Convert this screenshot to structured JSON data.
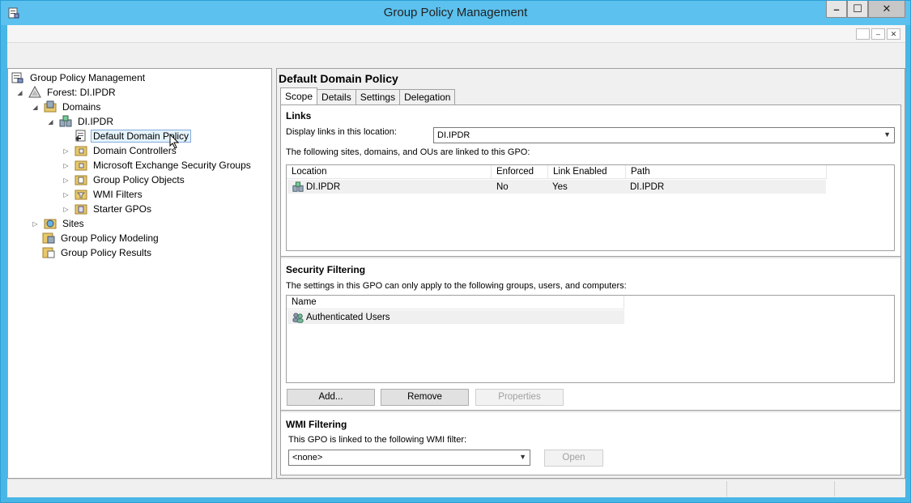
{
  "window": {
    "title": "Group Policy Management",
    "controls": {
      "minimize": "–",
      "maximize": "☐",
      "close": "✕"
    }
  },
  "mdi_controls": [
    "",
    "–",
    "✕"
  ],
  "tree": {
    "nodes": [
      {
        "label": "Group Policy Management",
        "icon": "gpmc-console-icon",
        "expander": "",
        "level": 0
      },
      {
        "label": "Forest: DI.IPDR",
        "icon": "forest-icon",
        "expander": "◢",
        "level": 1
      },
      {
        "label": "Domains",
        "icon": "domains-folder-icon",
        "expander": "◢",
        "level": 2
      },
      {
        "label": "DI.IPDR",
        "icon": "domain-icon",
        "expander": "◢",
        "level": 3
      },
      {
        "label": "Default Domain Policy",
        "icon": "gpo-link-icon",
        "expander": "",
        "level": 4,
        "selected": true
      },
      {
        "label": "Domain Controllers",
        "icon": "ou-folder-icon",
        "expander": "▷",
        "level": 4
      },
      {
        "label": "Microsoft Exchange Security Groups",
        "icon": "ou-folder-icon",
        "expander": "▷",
        "level": 4
      },
      {
        "label": "Group Policy Objects",
        "icon": "gpo-folder-icon",
        "expander": "▷",
        "level": 4
      },
      {
        "label": "WMI Filters",
        "icon": "wmi-folder-icon",
        "expander": "▷",
        "level": 4
      },
      {
        "label": "Starter GPOs",
        "icon": "starter-gpo-folder-icon",
        "expander": "▷",
        "level": 4
      },
      {
        "label": "Sites",
        "icon": "sites-icon",
        "expander": "▷",
        "level": 2
      },
      {
        "label": "Group Policy Modeling",
        "icon": "modeling-icon",
        "expander": "",
        "level": 2
      },
      {
        "label": "Group Policy Results",
        "icon": "results-icon",
        "expander": "",
        "level": 2
      }
    ]
  },
  "details": {
    "title": "Default Domain Policy",
    "tabs": [
      "Scope",
      "Details",
      "Settings",
      "Delegation"
    ],
    "links": {
      "section_title": "Links",
      "location_label": "Display links in this location:",
      "location_value": "DI.IPDR",
      "linked_label": "The following sites, domains, and OUs are linked to this GPO:",
      "columns": [
        "Location",
        "Enforced",
        "Link Enabled",
        "Path"
      ],
      "rows": [
        {
          "location": "DI.IPDR",
          "enforced": "No",
          "link_enabled": "Yes",
          "path": "DI.IPDR"
        }
      ]
    },
    "security": {
      "section_title": "Security Filtering",
      "description": "The settings in this GPO can only apply to the following groups, users, and computers:",
      "columns": [
        "Name"
      ],
      "rows": [
        {
          "name": "Authenticated Users"
        }
      ],
      "buttons": {
        "add": "Add...",
        "remove": "Remove",
        "properties": "Properties"
      }
    },
    "wmi": {
      "section_title": "WMI Filtering",
      "description": "This GPO is linked to the following WMI filter:",
      "filter_value": "<none>",
      "open_label": "Open"
    }
  }
}
